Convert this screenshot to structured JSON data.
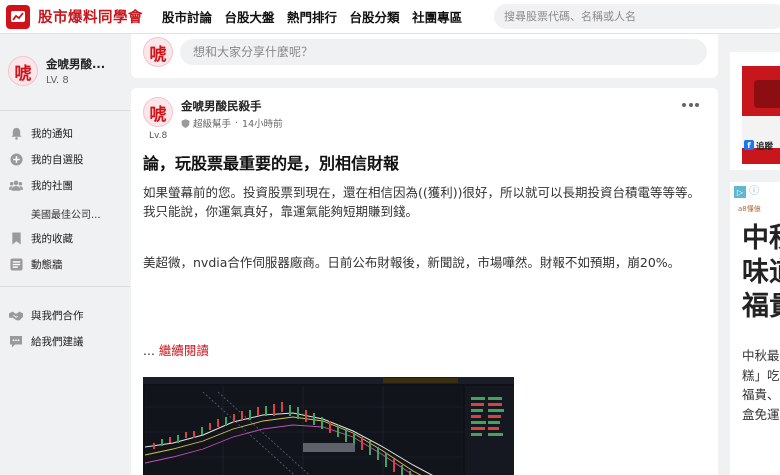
{
  "brand": {
    "name": "股市爆料同學會",
    "primary_color": "#d0131a"
  },
  "nav": [
    "股市討論",
    "台股大盤",
    "熱門排行",
    "台股分類",
    "社團專區"
  ],
  "search": {
    "placeholder": "搜尋股票代碼、名稱或人名"
  },
  "user": {
    "avatar_text": "唬",
    "name": "金唬男酸...",
    "level": "LV. 8"
  },
  "sidebar": {
    "items": [
      {
        "label": "我的通知",
        "icon": "bell-icon"
      },
      {
        "label": "我的自選股",
        "icon": "plus-circle-icon"
      },
      {
        "label": "我的社團",
        "icon": "group-icon"
      },
      {
        "label": "美國最佳公司...",
        "icon": ""
      },
      {
        "label": "我的收藏",
        "icon": "bookmark-icon"
      },
      {
        "label": "動態牆",
        "icon": "feed-icon"
      },
      {
        "label": "與我們合作",
        "icon": "handshake-icon"
      },
      {
        "label": "給我們建議",
        "icon": "feedback-icon"
      }
    ]
  },
  "composer": {
    "placeholder": "想和大家分享什麼呢？"
  },
  "post": {
    "author": "金唬男酸民殺手",
    "level": "Lv.8",
    "role": "超級幫手",
    "time": "14小時前",
    "title": "論，玩股票最重要的是，別相信財報",
    "body": [
      "如果螢幕前的您。投資股票到現在，還在相信因為((獲利))很好，所以就可以長期投資台積電等等等。",
      "我只能說，你運氣真好，靠運氣能夠短期賺到錢。",
      "",
      "美超微，nvdia合作伺服器廠商。日前公布財報後，新聞說，市場嘩然。財報不如預期，崩20%。"
    ],
    "read_more_prefix": "...",
    "read_more": "繼續閱讀"
  },
  "right": {
    "ad1": {
      "fb_text": "追蹤"
    },
    "ad2": {
      "brand": "a8懂億",
      "headline": "中秋\n味道\n福貴",
      "body": "中秋最\n糕」吃\n福貴、\n盒免運"
    }
  }
}
